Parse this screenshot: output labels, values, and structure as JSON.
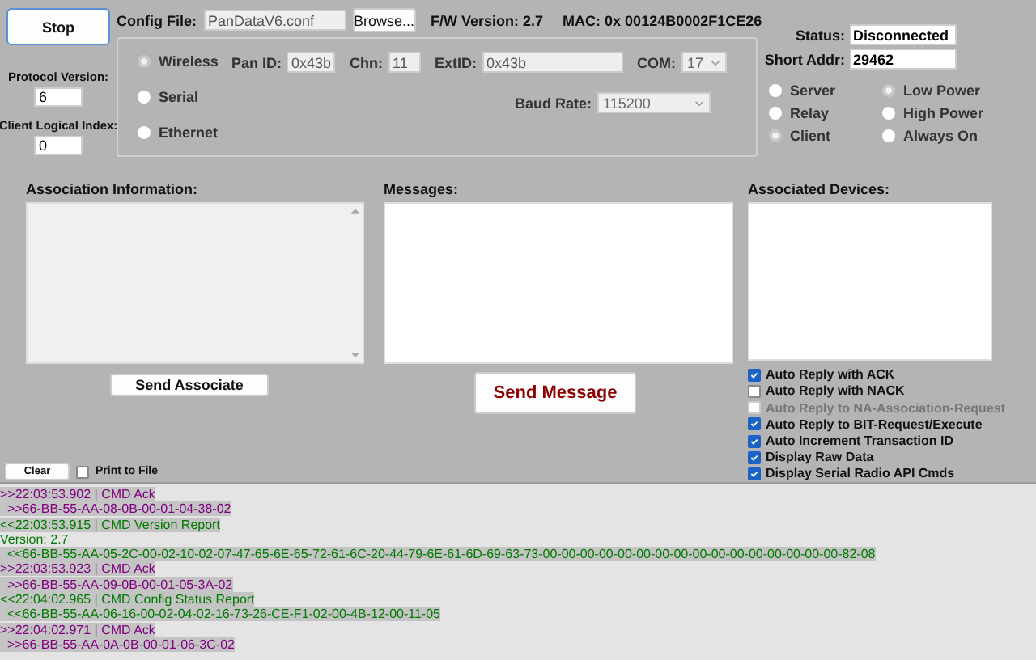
{
  "stop_button": "Stop",
  "protocol_version": {
    "label": "Protocol Version:",
    "value": "6"
  },
  "client_logical_index": {
    "label": "Client Logical Index:",
    "value": "0"
  },
  "config_file": {
    "label": "Config File:",
    "value": "PanDataV6.conf",
    "browse": "Browse..."
  },
  "fw_version": "F/W Version: 2.7",
  "mac": "MAC:  0x 00124B0002F1CE26",
  "interfaces": [
    {
      "label": "Wireless",
      "selected": true
    },
    {
      "label": "Serial",
      "selected": false
    },
    {
      "label": "Ethernet",
      "selected": false
    }
  ],
  "pan_id": {
    "label": "Pan ID:",
    "value": "0x43b"
  },
  "chn": {
    "label": "Chn:",
    "value": "11"
  },
  "ext_id": {
    "label": "ExtID:",
    "value": "0x43b"
  },
  "com": {
    "label": "COM:",
    "value": "17"
  },
  "baud_rate": {
    "label": "Baud Rate:",
    "value": "115200"
  },
  "status": {
    "label": "Status:",
    "value": "Disconnected"
  },
  "short_addr": {
    "label": "Short Addr:",
    "value": "29462"
  },
  "roles": [
    {
      "label": "Server",
      "selected": false
    },
    {
      "label": "Relay",
      "selected": false
    },
    {
      "label": "Client",
      "selected": true
    }
  ],
  "power_modes": [
    {
      "label": "Low Power",
      "selected": true
    },
    {
      "label": "High Power",
      "selected": false
    },
    {
      "label": "Always On",
      "selected": false
    }
  ],
  "association_information": {
    "label": "Association Information:"
  },
  "messages": {
    "label": "Messages:"
  },
  "associated_devices": {
    "label": "Associated Devices:"
  },
  "send_associate": "Send Associate",
  "send_message": "Send Message",
  "options": [
    {
      "label": "Auto Reply with ACK",
      "checked": true,
      "disabled": false
    },
    {
      "label": "Auto Reply with NACK",
      "checked": false,
      "disabled": false
    },
    {
      "label": "Auto Reply to NA-Association-Request",
      "checked": false,
      "disabled": true
    },
    {
      "label": "Auto Reply to BIT-Request/Execute",
      "checked": true,
      "disabled": false
    },
    {
      "label": "Auto Increment Transaction ID",
      "checked": true,
      "disabled": false
    },
    {
      "label": "Display Raw Data",
      "checked": true,
      "disabled": false
    },
    {
      "label": "Display Serial Radio API Cmds",
      "checked": true,
      "disabled": false
    }
  ],
  "clear_button": "Clear",
  "print_to_file": {
    "label": "Print to File",
    "checked": false
  },
  "log": [
    {
      "text": ">>22:03:53.902 | CMD Ack",
      "kind": "out",
      "highlighted": true
    },
    {
      "text": "  >>66-BB-55-AA-08-0B-00-01-04-38-02",
      "kind": "out",
      "highlighted": true
    },
    {
      "text": "<<22:03:53.915 | CMD Version Report",
      "kind": "in",
      "highlighted": true
    },
    {
      "text": "Version: 2.7",
      "kind": "in",
      "highlighted": false
    },
    {
      "text": "  <<66-BB-55-AA-05-2C-00-02-10-02-07-47-65-6E-65-72-61-6C-20-44-79-6E-61-6D-69-63-73-00-00-00-00-00-00-00-00-00-00-00-00-00-00-00-00-82-08",
      "kind": "in",
      "highlighted": true
    },
    {
      "text": ">>22:03:53.923 | CMD Ack",
      "kind": "out",
      "highlighted": true
    },
    {
      "text": "  >>66-BB-55-AA-09-0B-00-01-05-3A-02",
      "kind": "out",
      "highlighted": true
    },
    {
      "text": "<<22:04:02.965 | CMD Config Status Report",
      "kind": "in",
      "highlighted": true
    },
    {
      "text": "  <<66-BB-55-AA-06-16-00-02-04-02-16-73-26-CE-F1-02-00-4B-12-00-11-05",
      "kind": "in",
      "highlighted": true
    },
    {
      "text": ">>22:04:02.971 | CMD Ack",
      "kind": "out",
      "highlighted": true
    },
    {
      "text": "  >>66-BB-55-AA-0A-0B-00-01-06-3C-02",
      "kind": "out",
      "highlighted": true
    }
  ]
}
